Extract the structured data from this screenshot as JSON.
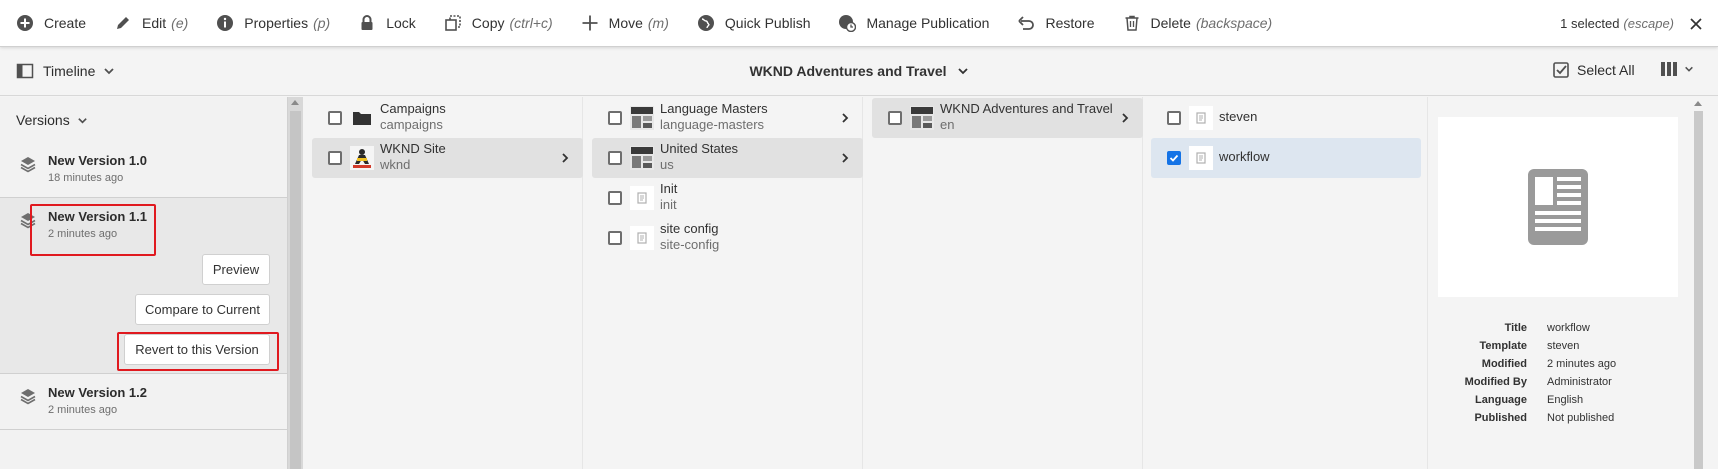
{
  "actionbar": {
    "actions": [
      {
        "label": "Create",
        "shortcut": ""
      },
      {
        "label": "Edit",
        "shortcut": "(e)"
      },
      {
        "label": "Properties",
        "shortcut": "(p)"
      },
      {
        "label": "Lock",
        "shortcut": ""
      },
      {
        "label": "Copy",
        "shortcut": "(ctrl+c)"
      },
      {
        "label": "Move",
        "shortcut": "(m)"
      },
      {
        "label": "Quick Publish",
        "shortcut": ""
      },
      {
        "label": "Manage Publication",
        "shortcut": ""
      },
      {
        "label": "Restore",
        "shortcut": ""
      },
      {
        "label": "Delete",
        "shortcut": "(backspace)"
      }
    ],
    "selection_text": "1 selected",
    "selection_shortcut": "(escape)"
  },
  "titlebar": {
    "rail_label": "Timeline",
    "breadcrumb": "WKND Adventures and Travel",
    "select_all": "Select All"
  },
  "rail": {
    "header": "Versions",
    "versions": [
      {
        "title": "New Version 1.0",
        "time": "18 minutes ago"
      },
      {
        "title": "New Version 1.1",
        "time": "2 minutes ago"
      },
      {
        "title": "New Version 1.2",
        "time": "2 minutes ago"
      }
    ],
    "buttons": {
      "preview": "Preview",
      "compare": "Compare to Current",
      "revert": "Revert to this Version"
    }
  },
  "columns": [
    {
      "items": [
        {
          "name": "Campaigns",
          "sub": "campaigns",
          "thumb": "folder-icon"
        },
        {
          "name": "WKND Site",
          "sub": "wknd",
          "thumb": "site-thumbnail"
        }
      ]
    },
    {
      "items": [
        {
          "name": "Language Masters",
          "sub": "language-masters",
          "thumb": "page-thumbnail"
        },
        {
          "name": "United States",
          "sub": "us",
          "thumb": "page-thumbnail"
        },
        {
          "name": "Init",
          "sub": "init",
          "thumb": "page-icon"
        },
        {
          "name": "site config",
          "sub": "site-config",
          "thumb": "page-icon"
        }
      ]
    },
    {
      "items": [
        {
          "name": "WKND Adventures and Travel",
          "sub": "en",
          "thumb": "page-thumbnail"
        }
      ]
    },
    {
      "items": [
        {
          "name": "steven",
          "sub": "",
          "thumb": "page-icon"
        },
        {
          "name": "workflow",
          "sub": "",
          "thumb": "page-icon"
        }
      ]
    }
  ],
  "preview": {
    "meta": [
      {
        "key": "Title",
        "value": "workflow"
      },
      {
        "key": "Template",
        "value": "steven"
      },
      {
        "key": "Modified",
        "value": "2 minutes ago"
      },
      {
        "key": "Modified By",
        "value": "Administrator"
      },
      {
        "key": "Language",
        "value": "English"
      },
      {
        "key": "Published",
        "value": "Not published"
      }
    ]
  },
  "colors": {
    "accent": "#1473e6",
    "annotation": "#e0191f",
    "selected_row": "#dde6f0",
    "highlight_row": "#e1e1e1"
  }
}
